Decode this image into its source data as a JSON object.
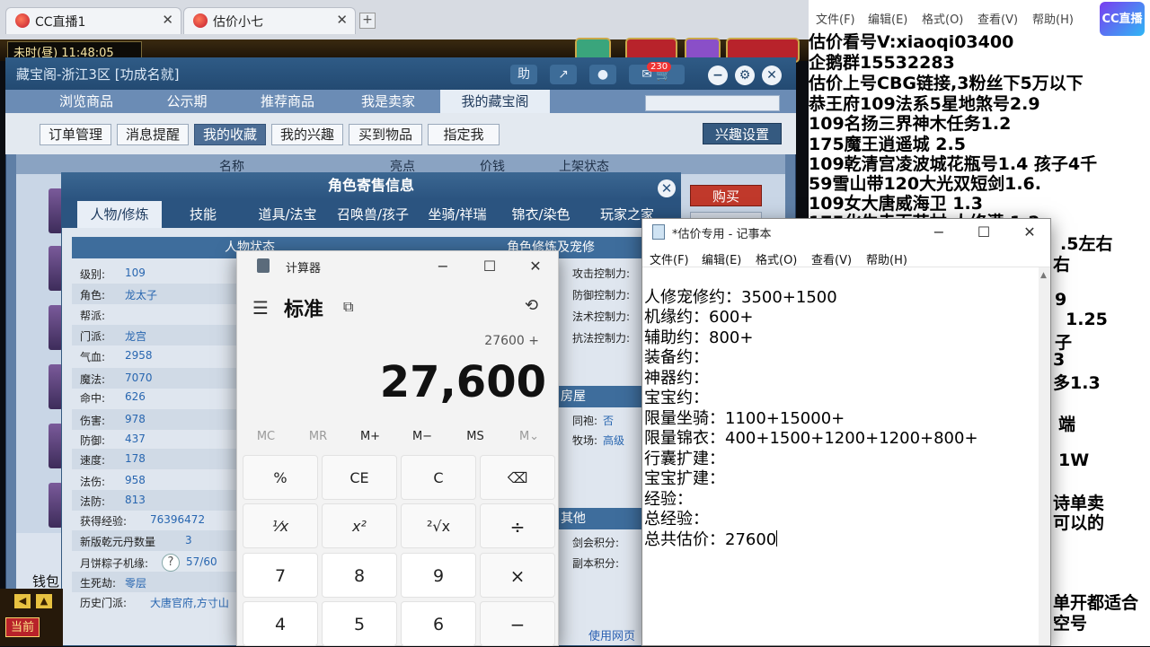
{
  "browser": {
    "tabs": [
      {
        "label": "CC直播1",
        "close": "✕"
      },
      {
        "label": "估价小七",
        "close": "✕"
      }
    ],
    "new_tab": "+"
  },
  "game": {
    "time": "未时(昼) 11:48:05",
    "current_label": "当前"
  },
  "treasure": {
    "title": "藏宝阁-浙江3区 [功成名就]",
    "help_label": "助",
    "badge": "230",
    "nav": [
      "浏览商品",
      "公示期",
      "推荐商品",
      "我是卖家",
      "我的藏宝阁"
    ],
    "sub": [
      "订单管理",
      "消息提醒",
      "我的收藏",
      "我的兴趣",
      "买到物品",
      "指定我"
    ],
    "interest_btn": "兴趣设置",
    "list_headers": [
      "名称",
      "亮点",
      "价钱",
      "上架状态"
    ],
    "buy": "购买",
    "wallet": "钱包"
  },
  "role": {
    "title": "角色寄售信息",
    "tabs": [
      "人物/修炼",
      "技能",
      "道具/法宝",
      "召唤兽/孩子",
      "坐骑/祥瑞",
      "锦衣/染色",
      "玩家之家"
    ],
    "section_left": "人物状态",
    "section_right": "角色修炼及宠修",
    "stats": [
      {
        "label": "级别:",
        "value": "109"
      },
      {
        "label": "角色:",
        "value": "龙太子"
      },
      {
        "label": "帮派:",
        "value": ""
      },
      {
        "label": "门派:",
        "value": "龙宫"
      },
      {
        "label": "气血:",
        "value": "2958"
      },
      {
        "label": "魔法:",
        "value": "7070"
      },
      {
        "label": "命中:",
        "value": "626"
      },
      {
        "label": "伤害:",
        "value": "978"
      },
      {
        "label": "防御:",
        "value": "437"
      },
      {
        "label": "速度:",
        "value": "178"
      },
      {
        "label": "法伤:",
        "value": "958"
      },
      {
        "label": "法防:",
        "value": "813"
      },
      {
        "label": "获得经验:",
        "value": "76396472"
      },
      {
        "label": "新版乾元丹数量",
        "value": "3"
      },
      {
        "label": "月饼粽子机缘:",
        "value": "57/60"
      },
      {
        "label": "生死劫:",
        "value": "零层"
      },
      {
        "label": "历史门派:",
        "value": "大唐官府,方寸山"
      }
    ],
    "cultivation": [
      "攻击控制力:",
      "防御控制力:",
      "法术控制力:",
      "抗法控制力:"
    ],
    "house_section": "房屋",
    "house": [
      {
        "label": "同袍:",
        "value": "否"
      },
      {
        "label": "牧场:",
        "value": "高级"
      }
    ],
    "other_section": "其他",
    "other": [
      "剑会积分:",
      "副本积分:"
    ],
    "use_page": "使用网页"
  },
  "calculator": {
    "title": "计算器",
    "mode": "标准",
    "expression": "27600 +",
    "display": "27,600",
    "memory": [
      "MC",
      "MR",
      "M+",
      "M−",
      "MS",
      "M⌄"
    ],
    "keys": [
      "%",
      "CE",
      "C",
      "⌫",
      "¹⁄x",
      "x²",
      "²√x",
      "÷",
      "7",
      "8",
      "9",
      "×",
      "4",
      "5",
      "6",
      "−"
    ]
  },
  "notepad": {
    "title": "*估价专用 - 记事本",
    "menu": [
      "文件(F)",
      "编辑(E)",
      "格式(O)",
      "查看(V)",
      "帮助(H)"
    ],
    "lines": [
      "人修宠修约：3500+1500",
      "机缘约：600+",
      "辅助约：800+",
      "装备约：",
      "神器约：",
      "宝宝约：",
      "限量坐骑：1100+15000+",
      "限量锦衣：400+1500+1200+1200+800+",
      "行囊扩建：",
      "宝宝扩建：",
      "经验：",
      "总经验：",
      "总共估价：27600"
    ]
  },
  "right_panel": {
    "menu": [
      "文件(F)",
      "编辑(E)",
      "格式(O)",
      "查看(V)",
      "帮助(H)"
    ],
    "logo": "CC直播",
    "lines": [
      "估价看号V:xiaoqi03400",
      "企鹅群15532283",
      "估价上号CBG链接,3粉丝下5万以下",
      "恭王府109法系5星地煞号2.9",
      "109名扬三界神木任务1.2",
      "175魔王逍遥城 2.5",
      "109乾清宫凌波城花瓶号1.4 孩子4千",
      "59雪山带120大光双短剑1.6.",
      "109女大唐威海卫  1.3",
      "175化生寺百花村 人修满 1.2"
    ],
    "fragments": [
      ".5左右",
      "右",
      "9",
      "1.25",
      "子",
      "3",
      "多1.3",
      "端",
      "1W",
      "诗单卖",
      "可以的",
      "单开都适合",
      "空号"
    ]
  }
}
